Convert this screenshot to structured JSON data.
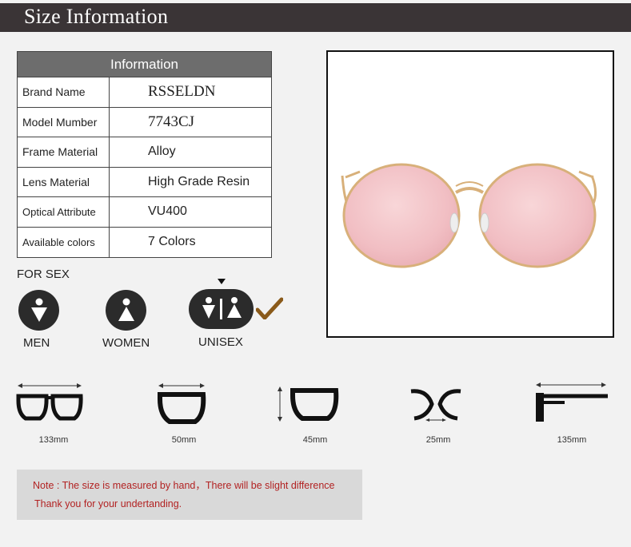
{
  "header": {
    "title": "Size Information"
  },
  "info": {
    "heading": "Information",
    "rows": [
      {
        "key": "Brand Name",
        "value": "RSSELDN"
      },
      {
        "key": "Model Mumber",
        "value": "7743CJ"
      },
      {
        "key": "Frame Material",
        "value": "Alloy"
      },
      {
        "key": "Lens Material",
        "value": "High Grade Resin"
      },
      {
        "key": "Optical Attribute",
        "value": "VU400"
      },
      {
        "key": "Available colors",
        "value": "7 Colors"
      }
    ]
  },
  "gender": {
    "heading": "FOR SEX",
    "men": "MEN",
    "women": "WOMEN",
    "unisex": "UNISEX",
    "selected": "UNISEX"
  },
  "measurements": {
    "frame_width": "133mm",
    "lens_width": "50mm",
    "lens_height": "45mm",
    "bridge_width": "25mm",
    "temple_length": "135mm"
  },
  "note": {
    "line1": "Note : The size is measured by hand，There will be slight difference",
    "line2": "Thank you for your undertanding."
  },
  "colors": {
    "title_bar": "#3a3436",
    "lens": "#f4c4c8",
    "frame": "#d8b07a",
    "note_text": "#b22222",
    "check": "#8a5a1a"
  }
}
